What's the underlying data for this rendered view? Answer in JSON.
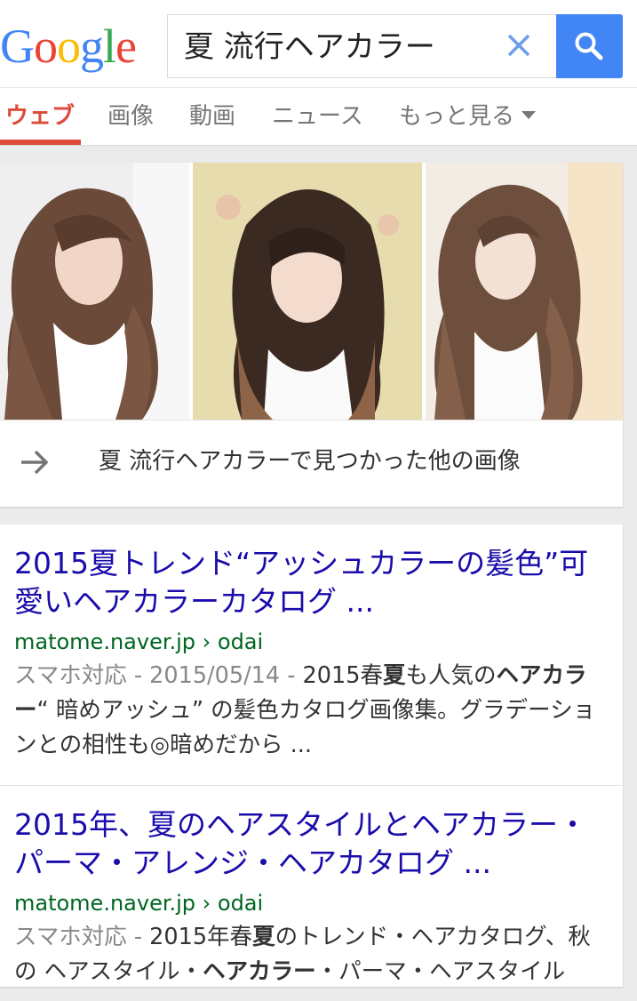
{
  "logo": {
    "letters": [
      "G",
      "o",
      "o",
      "g",
      "l",
      "e"
    ],
    "colors": [
      "#4285f4",
      "#ea4335",
      "#fbbc05",
      "#4285f4",
      "#34a853",
      "#ea4335"
    ]
  },
  "search": {
    "query": "夏 流行ヘアカラー",
    "clear_icon": "close-icon",
    "button_icon": "search-icon",
    "button_color": "#4285f4"
  },
  "tabs": [
    {
      "label": "ウェブ",
      "active": true
    },
    {
      "label": "画像",
      "active": false
    },
    {
      "label": "動画",
      "active": false
    },
    {
      "label": "ニュース",
      "active": false
    },
    {
      "label": "もっと見る",
      "active": false
    }
  ],
  "image_block": {
    "thumbnails": [
      "hair-photo-1",
      "hair-photo-2",
      "hair-photo-3"
    ],
    "more_images_text": "夏 流行ヘアカラーで見つかった他の画像",
    "arrow_icon": "arrow-right-icon"
  },
  "results": [
    {
      "title": "2015夏トレンド“アッシュカラーの髪色”可愛いヘアカラーカタログ ...",
      "url": "matome.naver.jp › odai",
      "snippet": {
        "meta": "スマホ対応 - 2015/05/14 - ",
        "parts": [
          {
            "text": "2015春",
            "bold": false
          },
          {
            "text": "夏",
            "bold": true
          },
          {
            "text": "も人気の",
            "bold": false
          },
          {
            "text": "ヘアカラー",
            "bold": true
          },
          {
            "text": "“ 暗めアッシュ” の髪色カタログ画像集。グラデーションとの相性も◎暗めだから ...",
            "bold": false
          }
        ]
      }
    },
    {
      "title": "2015年、夏のヘアスタイルとヘアカラー・パーマ・アレンジ・ヘアカタログ ...",
      "url": "matome.naver.jp › odai",
      "snippet": {
        "meta": "スマホ対応 - ",
        "parts": [
          {
            "text": "2015年春",
            "bold": false
          },
          {
            "text": "夏",
            "bold": true
          },
          {
            "text": "のトレンド・ヘアカタログ、秋の ヘアスタイル・",
            "bold": false
          },
          {
            "text": "ヘアカラー",
            "bold": true
          },
          {
            "text": "・パーマ・ヘアスタイル",
            "bold": false
          }
        ]
      }
    }
  ],
  "colors": {
    "link": "#1a0dab",
    "url": "#006621",
    "active_tab": "#dd4b39"
  }
}
